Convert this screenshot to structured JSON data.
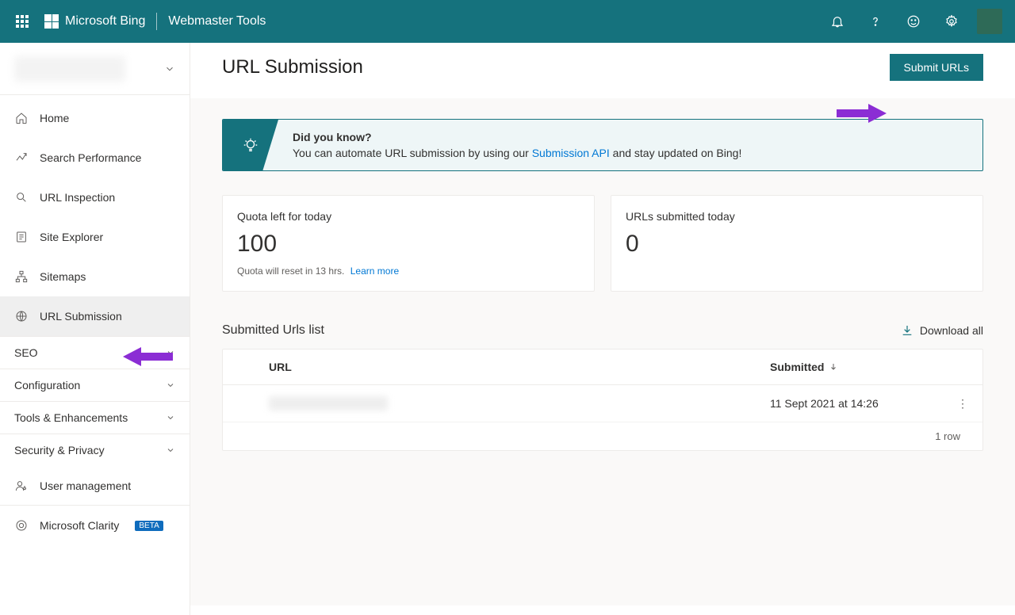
{
  "header": {
    "brand": "Microsoft Bing",
    "product": "Webmaster Tools"
  },
  "sidebar": {
    "items": [
      {
        "icon": "home-icon",
        "label": "Home"
      },
      {
        "icon": "trend-icon",
        "label": "Search Performance"
      },
      {
        "icon": "search-icon",
        "label": "URL Inspection"
      },
      {
        "icon": "explorer-icon",
        "label": "Site Explorer"
      },
      {
        "icon": "sitemap-icon",
        "label": "Sitemaps"
      },
      {
        "icon": "globe-icon",
        "label": "URL Submission"
      }
    ],
    "sections": [
      {
        "label": "SEO"
      },
      {
        "label": "Configuration"
      },
      {
        "label": "Tools & Enhancements"
      },
      {
        "label": "Security & Privacy"
      }
    ],
    "user_mgmt_label": "User management",
    "clarity_label": "Microsoft Clarity",
    "clarity_badge": "BETA"
  },
  "page": {
    "title": "URL Submission",
    "submit_label": "Submit URLs",
    "banner_title": "Did you know?",
    "banner_text_pre": "You can automate URL submission by using our ",
    "banner_link": "Submission API",
    "banner_text_post": " and stay updated on Bing!",
    "quota_label": "Quota left for today",
    "quota_value": "100",
    "quota_sub": "Quota will reset in 13 hrs.",
    "quota_learn": "Learn more",
    "submitted_label": "URLs submitted today",
    "submitted_value": "0",
    "list_title": "Submitted Urls list",
    "download_label": "Download all",
    "col_url": "URL",
    "col_submitted": "Submitted",
    "rows": [
      {
        "url": "",
        "submitted": "11 Sept 2021 at 14:26"
      }
    ],
    "footer_count": "1 row"
  }
}
